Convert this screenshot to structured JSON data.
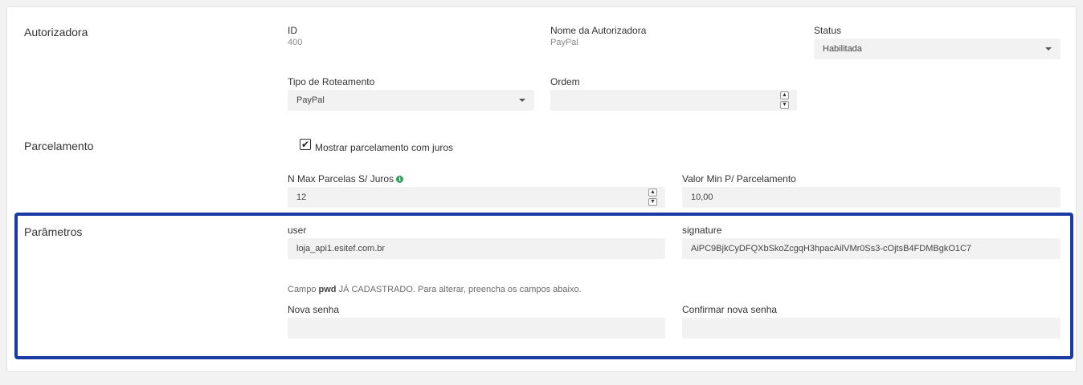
{
  "sections": {
    "autorizadora": "Autorizadora",
    "parcelamento": "Parcelamento",
    "parametros": "Parâmetros"
  },
  "autorizadora": {
    "id_label": "ID",
    "id_value": "400",
    "nome_label": "Nome da Autorizadora",
    "nome_value": "PayPal",
    "status_label": "Status",
    "status_value": "Habilitada",
    "tipo_label": "Tipo de Roteamento",
    "tipo_value": "PayPal",
    "ordem_label": "Ordem",
    "ordem_value": ""
  },
  "parcelamento": {
    "checkbox_label": "Mostrar parcelamento com juros",
    "checkbox_checked": true,
    "max_parcelas_label": "N Max Parcelas S/ Juros",
    "max_parcelas_value": "12",
    "valor_min_label": "Valor Min P/ Parcelamento",
    "valor_min_value": "10,00"
  },
  "parametros": {
    "user_label": "user",
    "user_value": "loja_api1.esitef.com.br",
    "signature_label": "signature",
    "signature_value": "AiPC9BjkCyDFQXbSkoZcgqH3hpacAilVMr0Ss3-cOjtsB4FDMBgkO1C7",
    "hint_prefix": "Campo",
    "hint_field": "pwd",
    "hint_suffix": "JÁ CADASTRADO. Para alterar, preencha os campos abaixo.",
    "nova_senha_label": "Nova senha",
    "nova_senha_value": "",
    "confirmar_senha_label": "Confirmar nova senha",
    "confirmar_senha_value": ""
  },
  "colors": {
    "highlight_border": "#1a3aa3",
    "field_background": "#f2f2f2",
    "info_icon": "#2e9e5a"
  },
  "icons": {
    "status_dropdown": "chevron-down-icon",
    "tipo_dropdown": "chevron-down-icon",
    "info": "info-icon",
    "checkbox": "checkmark-icon"
  }
}
